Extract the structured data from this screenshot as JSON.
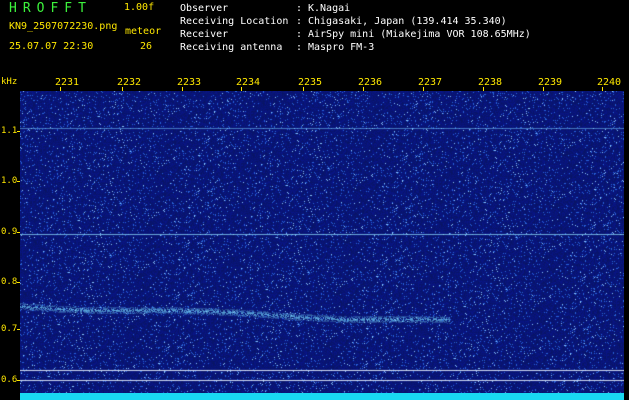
{
  "header": {
    "brand": "HROFFT",
    "version": "1.00f",
    "filename": "KN9_2507072230.png",
    "type": "meteor",
    "timestamp": "25.07.07 22:30",
    "count": "26",
    "meta": [
      {
        "key": "Observer",
        "value": "K.Nagai"
      },
      {
        "key": "Receiving Location",
        "value": "Chigasaki, Japan (139.414 35.340)"
      },
      {
        "key": "Receiver",
        "value": "AirSpy mini (Miakejima VOR 108.65MHz)"
      },
      {
        "key": "Receiving antenna",
        "value": "Maspro FM-3"
      }
    ]
  },
  "axis": {
    "y_unit": "kHz",
    "y_ticks": [
      "1.1",
      "1.0",
      "0.9",
      "0.8",
      "0.7",
      "0.6"
    ],
    "x_ticks": [
      "2231",
      "2232",
      "2233",
      "2234",
      "2235",
      "2236",
      "2237",
      "2238",
      "2239",
      "2240"
    ]
  },
  "colors": {
    "background": "#000000",
    "label_yellow": "#ffe800",
    "brand_green": "#3cf23c",
    "noise_base": "#0a1a6e",
    "signal_cyan": "#19d8f2"
  }
}
